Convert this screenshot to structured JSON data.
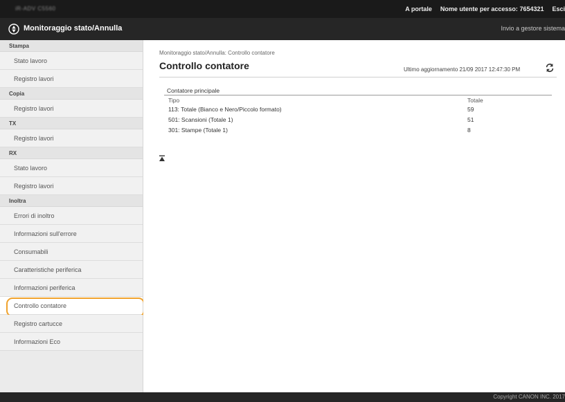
{
  "topbar": {
    "model": "iR-ADV C5560",
    "portal": "A portale",
    "user_label": "Nome utente per accesso:",
    "user_id": "7654321",
    "logout": "Esci"
  },
  "titlebar": {
    "title": "Monitoraggio stato/Annulla",
    "send_link": "Invio a gestore sistema"
  },
  "sidebar": {
    "groups": [
      {
        "header": "Stampa",
        "items": [
          "Stato lavoro",
          "Registro lavori"
        ]
      },
      {
        "header": "Copia",
        "items": [
          "Registro lavori"
        ]
      },
      {
        "header": "TX",
        "items": [
          "Registro lavori"
        ]
      },
      {
        "header": "RX",
        "items": [
          "Stato lavoro",
          "Registro lavori"
        ]
      },
      {
        "header": "Inoltra",
        "items": [
          "Errori di inoltro"
        ]
      }
    ],
    "extra_items": [
      "Informazioni sull'errore",
      "Consumabili",
      "Caratteristiche periferica",
      "Informazioni periferica",
      "Controllo contatore",
      "Registro cartucce",
      "Informazioni Eco"
    ],
    "active_item": "Controllo contatore"
  },
  "main": {
    "breadcrumb": "Monitoraggio stato/Annulla: Controllo contatore",
    "title": "Controllo contatore",
    "last_update": "Ultimo aggiornamento 21/09 2017 12:47:30 PM",
    "section_title": "Contatore principale",
    "columns": [
      "Tipo",
      "Totale"
    ],
    "rows": [
      {
        "type": "113: Totale (Bianco e Nero/Piccolo formato)",
        "total": "59"
      },
      {
        "type": "501: Scansioni (Totale 1)",
        "total": "51"
      },
      {
        "type": "301: Stampe (Totale 1)",
        "total": "8"
      }
    ]
  },
  "footer": {
    "copyright": "Copyright CANON INC. 2017"
  },
  "colors": {
    "active_outline": "#f0a22c",
    "header_bg": "#262626",
    "sidebar_bg": "#ebebeb"
  }
}
